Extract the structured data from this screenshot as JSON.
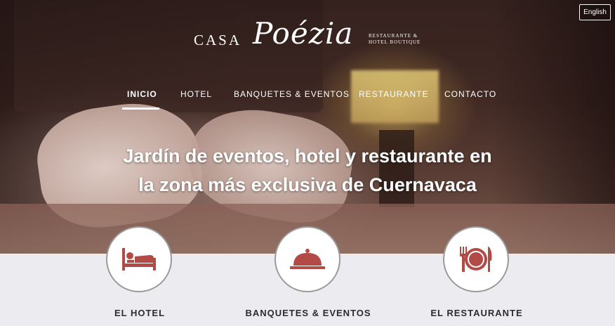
{
  "language_button": "English",
  "logo": {
    "casa": "CASA",
    "poezia": "Poézia",
    "tagline_1": "RESTAURANTE &",
    "tagline_2": "HOTEL BOUTIQUE"
  },
  "nav": [
    {
      "label": "INICIO",
      "active": true
    },
    {
      "label": "HOTEL",
      "active": false
    },
    {
      "label": "BANQUETES & EVENTOS",
      "active": false
    },
    {
      "label": "RESTAURANTE",
      "active": false
    },
    {
      "label": "CONTACTO",
      "active": false
    }
  ],
  "hero": {
    "title_line_1": "Jardín de eventos, hotel y restaurante en",
    "title_line_2": "la zona más exclusiva de Cuernavaca"
  },
  "features": [
    {
      "label": "EL HOTEL",
      "icon": "bed-icon"
    },
    {
      "label": "BANQUETES & EVENTOS",
      "icon": "cloche-icon"
    },
    {
      "label": "EL RESTAURANTE",
      "icon": "plate-cutlery-icon"
    }
  ],
  "colors": {
    "accent": "#b24a45",
    "background": "#ecebf0",
    "text": "#2c2c2c"
  }
}
